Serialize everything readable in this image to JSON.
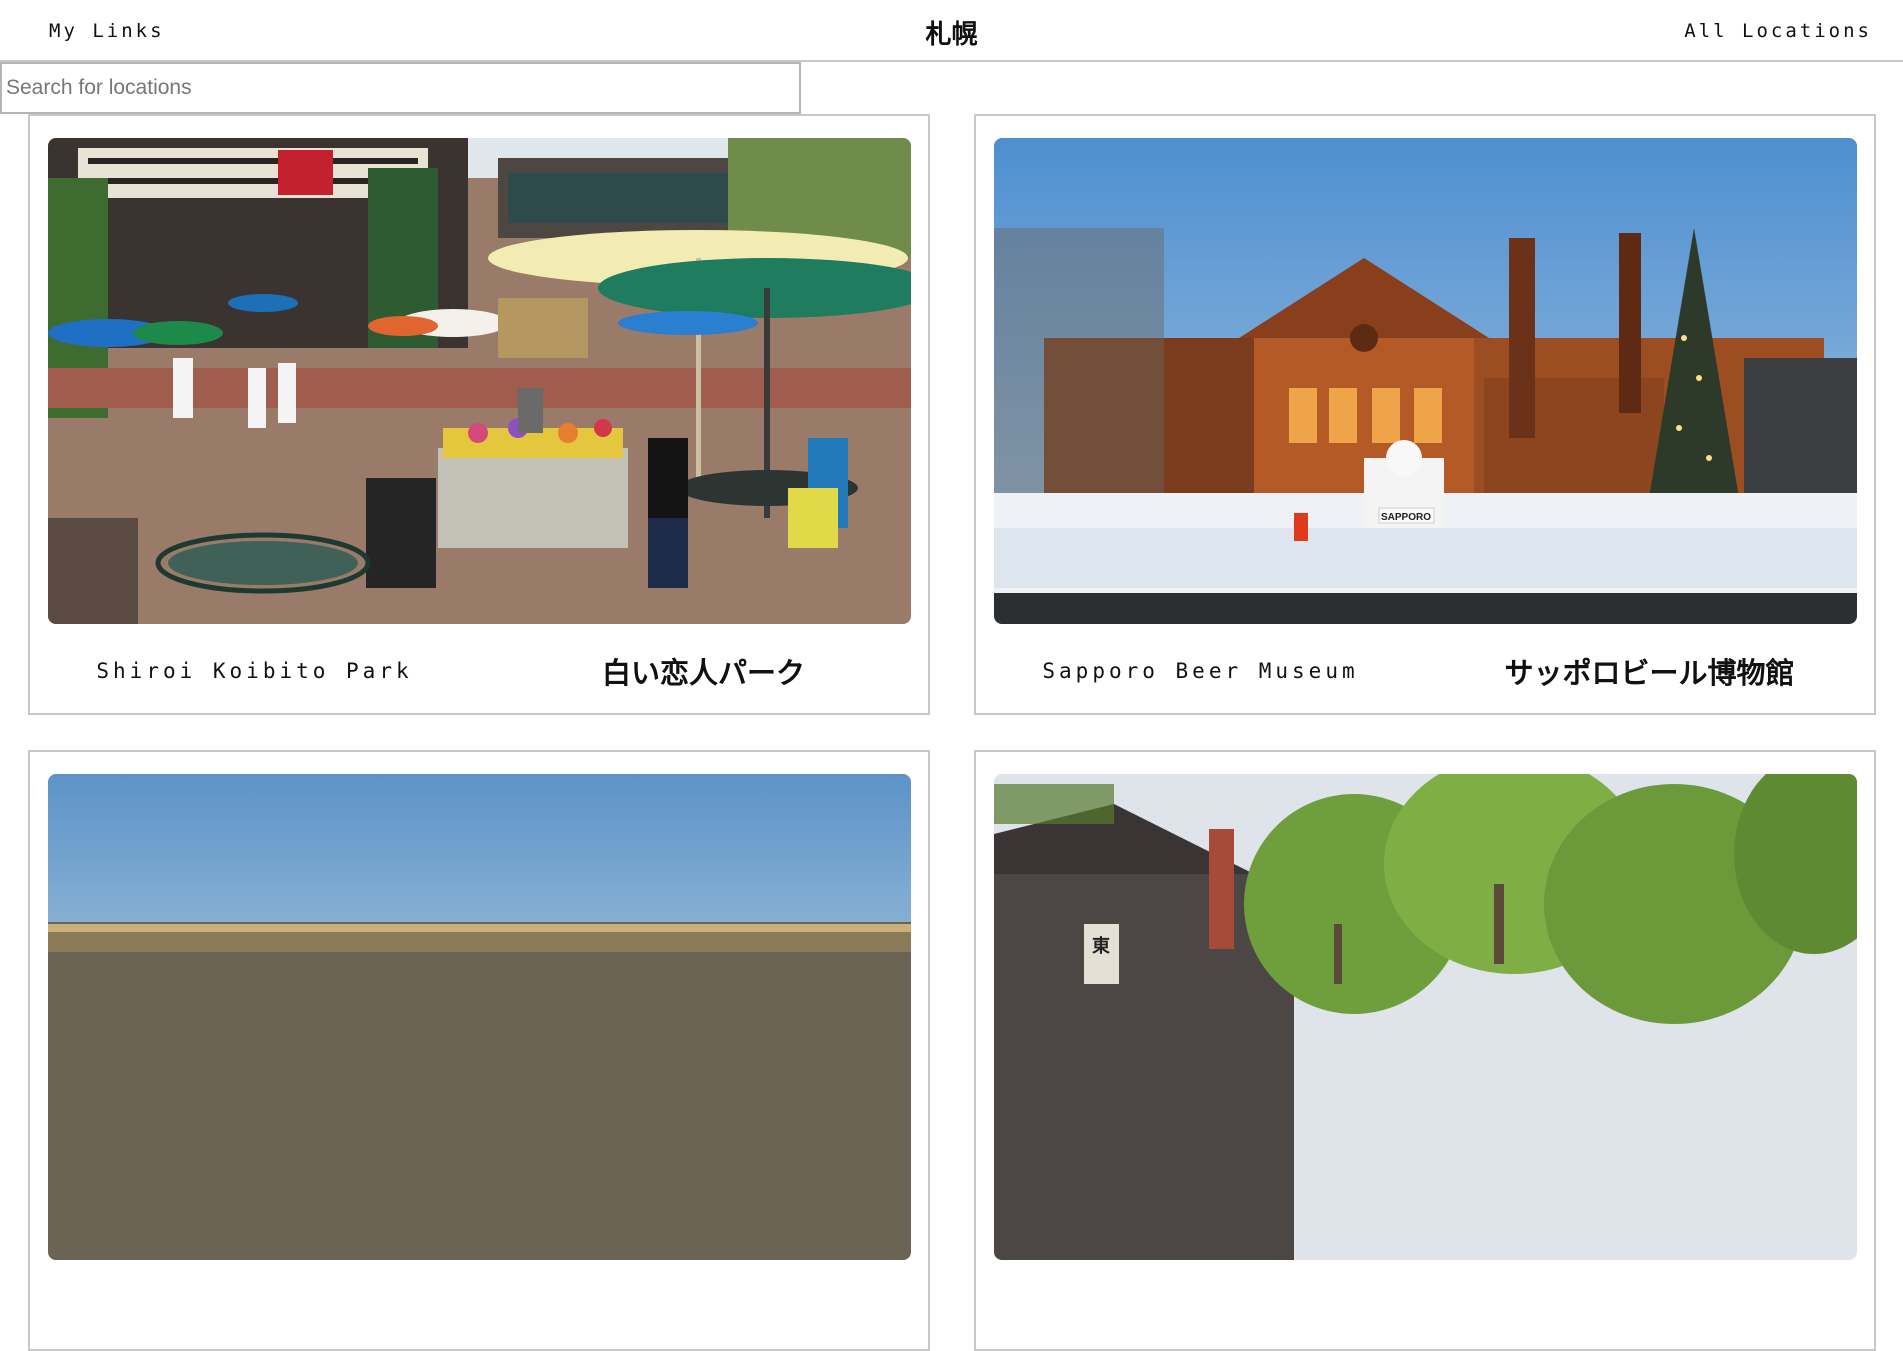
{
  "header": {
    "left_link": "My Links",
    "title": "札幌",
    "right_link": "All Locations"
  },
  "search": {
    "placeholder": "Search for locations",
    "value": ""
  },
  "locations": [
    {
      "name_en": "Shiroi Koibito Park",
      "name_ja": "白い恋人パーク",
      "photo": "plaza-cafe-photo"
    },
    {
      "name_en": "Sapporo Beer Museum",
      "name_ja": "サッポロビール博物館",
      "photo": "brick-museum-snow-photo",
      "sign_text": "SAPPORO"
    },
    {
      "name_en": "",
      "name_ja": "",
      "photo": "city-night-view-photo"
    },
    {
      "name_en": "",
      "name_ja": "",
      "photo": "historic-village-photo",
      "sign_text": "東"
    }
  ],
  "colors": {
    "border": "#c8c8c8",
    "text": "#111111",
    "search_border": "#b5b5b5"
  }
}
